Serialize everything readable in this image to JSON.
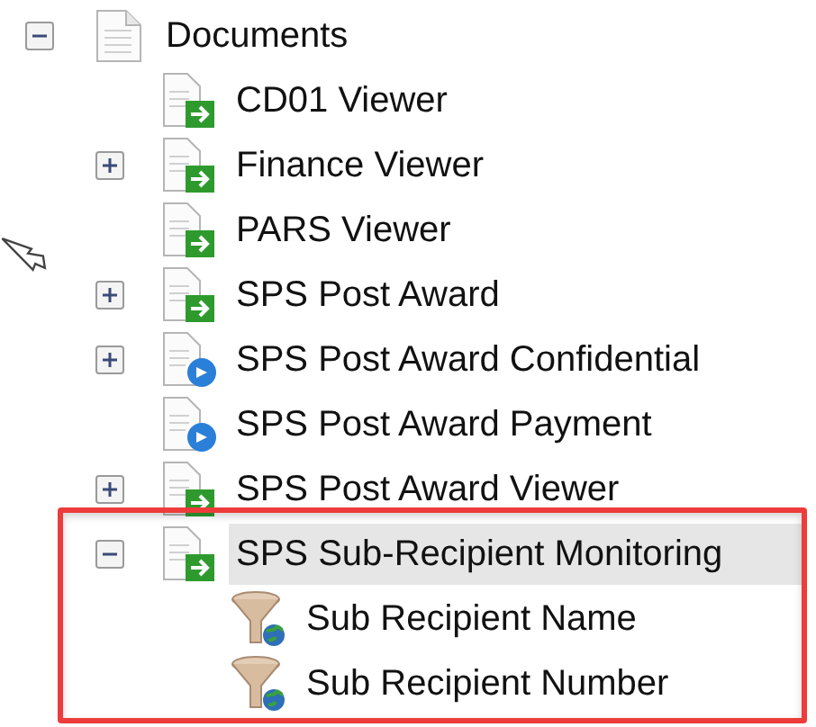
{
  "tree": {
    "label": "Documents",
    "kind": "document",
    "expanded": true,
    "selected": false,
    "children": [
      {
        "label": "CD01 Viewer",
        "kind": "viewer",
        "selected": false
      },
      {
        "label": "Finance Viewer",
        "kind": "viewer",
        "expanded": false,
        "selected": false
      },
      {
        "label": "PARS Viewer",
        "kind": "viewer",
        "selected": false
      },
      {
        "label": "SPS Post Award",
        "kind": "viewer",
        "expanded": false,
        "selected": false
      },
      {
        "label": "SPS Post Award Confidential",
        "kind": "linked",
        "expanded": false,
        "selected": false
      },
      {
        "label": "SPS Post Award Payment",
        "kind": "linked",
        "selected": false
      },
      {
        "label": "SPS Post Award Viewer",
        "kind": "viewer",
        "expanded": false,
        "selected": false
      },
      {
        "label": "SPS Sub-Recipient Monitoring",
        "kind": "viewer",
        "expanded": true,
        "selected": true,
        "children": [
          {
            "label": "Sub Recipient Name",
            "kind": "filter",
            "selected": false
          },
          {
            "label": "Sub Recipient Number",
            "kind": "filter",
            "selected": false
          }
        ]
      }
    ]
  }
}
